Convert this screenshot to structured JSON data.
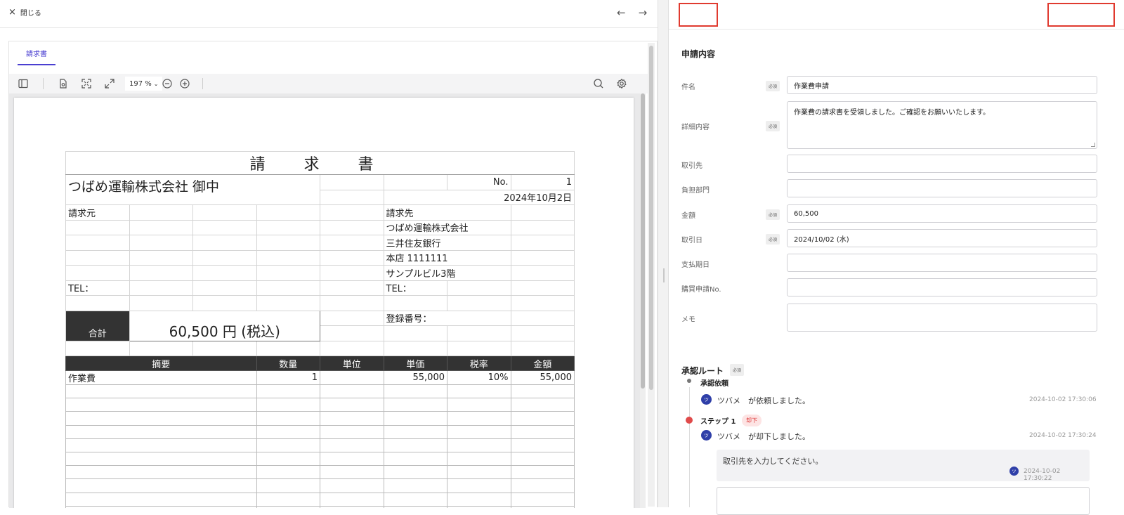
{
  "topbar": {
    "close_label": "閉じる",
    "close_icon": "×",
    "prev_icon": "←",
    "next_icon": "→"
  },
  "viewer": {
    "tab_label": "請求書",
    "zoom": "197 %",
    "zoom_chevron": "⌄"
  },
  "invoice": {
    "title": "請 求 書",
    "client": "つばめ運輸株式会社 御中",
    "no_label": "No.",
    "no_value": "1",
    "date": "2024年10月2日",
    "from_label": "請求元",
    "to_label": "請求先",
    "to_lines": [
      "つばめ運輸株式会社",
      "三井住友銀行",
      "本店 1111111",
      "サンプルビル3階"
    ],
    "tel_label": "TEL：",
    "reg_label": "登録番号：",
    "total_label": "合計",
    "total_value": "60,500 円 (税込)",
    "headers": [
      "摘要",
      "数量",
      "単位",
      "単価",
      "税率",
      "金額"
    ],
    "items": [
      {
        "name": "作業費",
        "qty": "1",
        "unit": "",
        "price": "55,000",
        "tax": "10%",
        "amount": "55,000"
      }
    ]
  },
  "form": {
    "section_title": "申請内容",
    "required_label": "必須",
    "fields": [
      {
        "label": "件名",
        "value": "作業費申請"
      },
      {
        "label": "詳細内容",
        "value": "作業費の請求書を受領しました。ご確認をお願いいたします。"
      },
      {
        "label": "取引先",
        "value": ""
      },
      {
        "label": "負担部門",
        "value": ""
      },
      {
        "label": "金額",
        "value": "60,500"
      },
      {
        "label": "取引日",
        "value": "2024/10/02 (水)"
      },
      {
        "label": "支払期日",
        "value": ""
      },
      {
        "label": "購買申請No.",
        "value": ""
      },
      {
        "label": "メモ",
        "value": ""
      }
    ]
  },
  "approval": {
    "title": "承認ルート",
    "required_label": "必須",
    "request_title": "承認依頼",
    "avatar_initial": "ツ",
    "request_text": "ツバメ　が依頼しました。",
    "request_time": "2024-10-02 17:30:06",
    "step1_title": "ステップ 1",
    "step1_badge": "却下",
    "step1_text": "ツバメ　が却下しました。",
    "step1_time": "2024-10-02 17:30:24",
    "comment_text": "取引先を入力してください。",
    "comment_time": "2024-10-02 17:30:22"
  },
  "colors": {
    "accent": "#4a3fd1",
    "highlight": "#e03a2f",
    "reject": "#e04a4a",
    "avatar": "#2f3fa8"
  }
}
